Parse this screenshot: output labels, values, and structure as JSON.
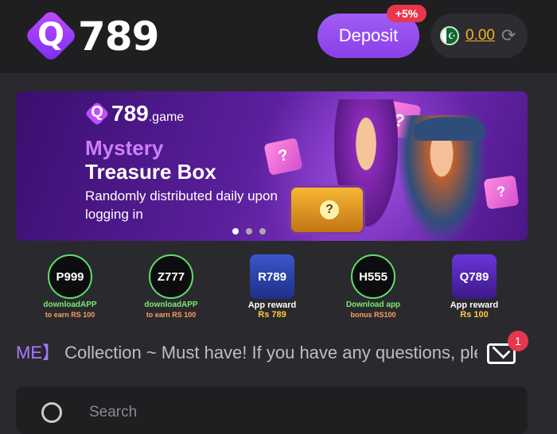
{
  "header": {
    "logo_letter": "Q",
    "logo_number": "789",
    "deposit_label": "Deposit",
    "deposit_bonus": "+5%",
    "balance": "0.00",
    "currency_flag": "pakistan-flag"
  },
  "banner": {
    "logo_letter": "Q",
    "logo_number": "789",
    "logo_suffix": ".game",
    "title_line1": "Mystery",
    "title_line2": "Treasure Box",
    "subtitle": "Randomly distributed daily upon logging in",
    "chest_symbol": "?",
    "gift_symbol": "?",
    "active_slide": 0,
    "slide_count": 3
  },
  "apps": [
    {
      "icon_text": "P999",
      "line1": "downloadAPP",
      "line2": "to earn RS 100",
      "style": "green"
    },
    {
      "icon_text": "Z777",
      "line1": "downloadAPP",
      "line2": "to earn RS 100",
      "style": "green"
    },
    {
      "icon_text": "R789",
      "line1": "App reward",
      "line2": "Rs 789",
      "style": "blue"
    },
    {
      "icon_text": "H555",
      "line1": "Download app",
      "line2": "bonus RS100",
      "style": "green"
    },
    {
      "icon_text": "Q789",
      "line1": "App reward",
      "line2": "Rs 100",
      "style": "purple"
    }
  ],
  "notice": {
    "prefix": "ME】",
    "text": " Collection ~ Must have! If you have any questions, ple"
  },
  "mail_badge": "1",
  "search": {
    "placeholder": "Search"
  },
  "colors": {
    "accent": "#9b59f2",
    "balance": "#f5b31b",
    "badge": "#e8364c"
  }
}
